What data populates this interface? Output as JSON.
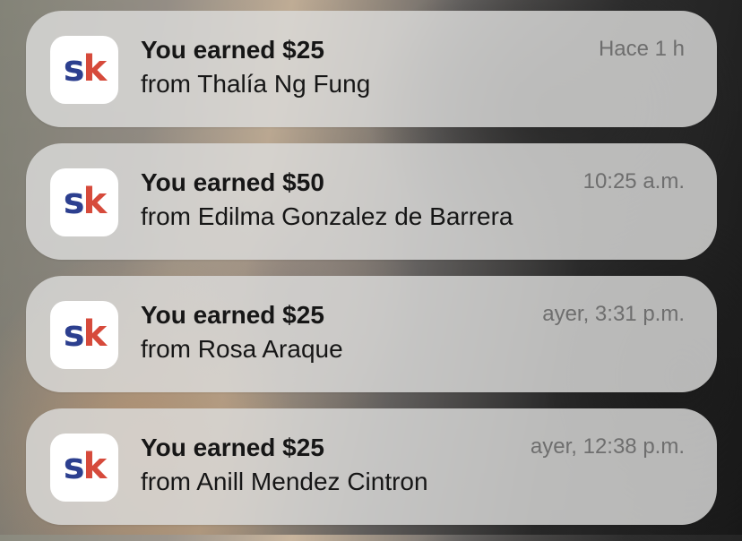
{
  "notifications": [
    {
      "title": "You earned $25",
      "body": "from Thalía Ng Fung",
      "time": "Hace 1 h",
      "app_icon": "sk-logo-icon"
    },
    {
      "title": "You earned $50",
      "body": "from Edilma Gonzalez de Barrera",
      "time": "10:25 a.m.",
      "app_icon": "sk-logo-icon"
    },
    {
      "title": "You earned $25",
      "body": "from Rosa Araque",
      "time": "ayer, 3:31 p.m.",
      "app_icon": "sk-logo-icon"
    },
    {
      "title": "You earned $25",
      "body": "from Anill Mendez Cintron",
      "time": "ayer, 12:38 p.m.",
      "app_icon": "sk-logo-icon"
    }
  ],
  "app_logo": {
    "first_letter": "s",
    "second_letter": "k"
  },
  "colors": {
    "logo_s": "#2c3f8f",
    "logo_k": "#d64a3b",
    "card_background": "rgba(220,220,218,0.82)",
    "time_text": "#6e6e6e"
  }
}
